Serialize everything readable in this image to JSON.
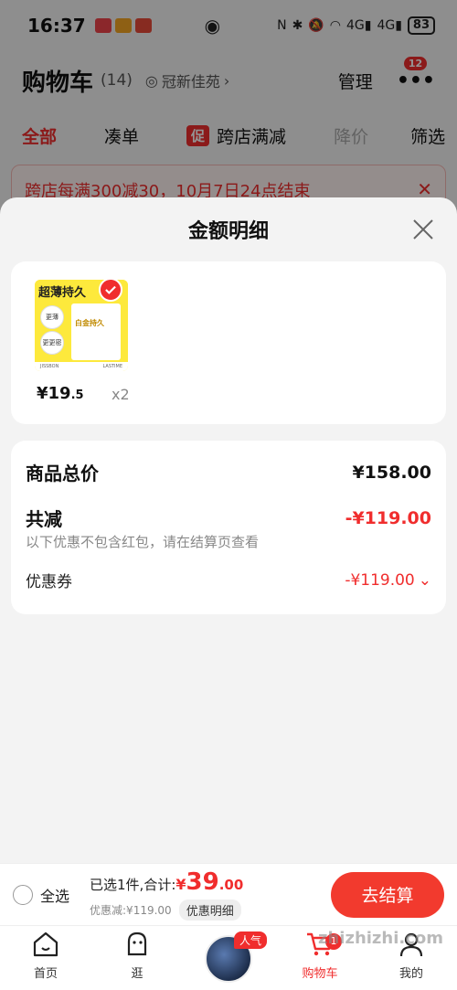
{
  "status_bar": {
    "time": "16:37",
    "battery": "83",
    "icons": [
      "eye-icon",
      "nfc-icon",
      "bluetooth-icon",
      "mute-icon",
      "wifi-icon",
      "signal-4g-icon",
      "signal-4g-icon",
      "battery-icon"
    ]
  },
  "cart": {
    "title": "购物车",
    "count": "(14)",
    "location": "冠新佳苑",
    "manage_label": "管理",
    "more_badge": "12"
  },
  "filter_tabs": [
    {
      "label": "全部",
      "active": true
    },
    {
      "label": "凑单"
    },
    {
      "tag": "促",
      "label": "跨店满减"
    },
    {
      "label": "降价",
      "muted": true
    },
    {
      "label": "筛选"
    }
  ],
  "promo_banner": {
    "text": "跨店每满300减30，10月7日24点结束"
  },
  "sheet": {
    "title": "金额明细",
    "product": {
      "thumb_title": "超薄持久",
      "thumb_box_label": "白金持久",
      "thumb_circle1": "更薄20%",
      "thumb_circle2": "更更密",
      "thumb_foot_left": "JISSBON",
      "thumb_foot_right": "LASTIME",
      "price_symbol": "¥",
      "price_int": "19",
      "price_dec": ".5",
      "qty": "x2"
    },
    "summary": {
      "total_label": "商品总价",
      "total_value": "¥158.00",
      "discount_label": "共减",
      "discount_value": "-¥119.00",
      "note": "以下优惠不包含红包，请在结算页查看",
      "coupon_label": "优惠券",
      "coupon_value": "-¥119.00"
    }
  },
  "checkout": {
    "select_all": "全选",
    "selected_text": "已选1件,合计:",
    "currency": "¥",
    "total_int": "39",
    "total_dec": ".00",
    "discount_text": "优惠减:¥119.00",
    "detail_label": "优惠明细",
    "button": "去结算"
  },
  "bottom_nav": {
    "home": "首页",
    "browse": "逛",
    "hot_tag": "人气",
    "cart": "购物车",
    "cart_badge": "1",
    "me": "我的"
  },
  "watermark": "zhizhizhi.com",
  "colors": {
    "accent": "#f02d2d",
    "button": "#f23a2e",
    "thumb_bg": "#fde93c"
  }
}
